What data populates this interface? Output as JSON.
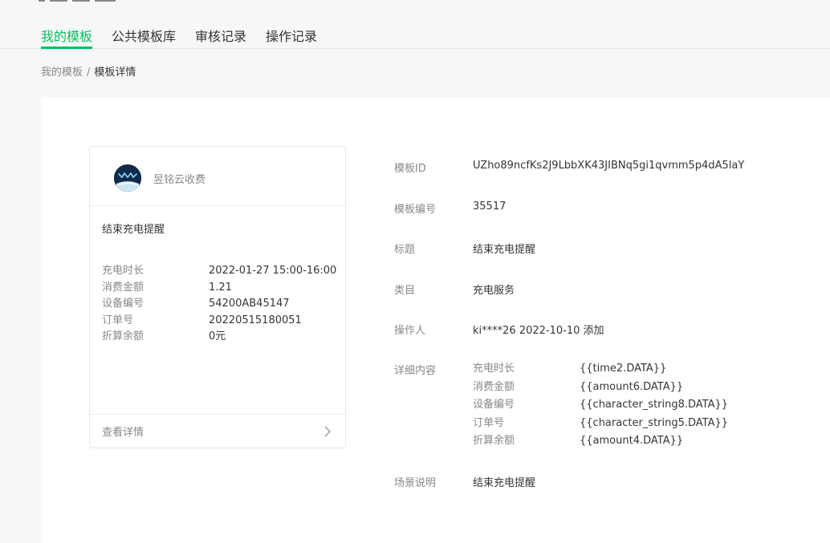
{
  "tabs": [
    {
      "label": "我的模板",
      "active": true
    },
    {
      "label": "公共模板库",
      "active": false
    },
    {
      "label": "审核记录",
      "active": false
    },
    {
      "label": "操作记录",
      "active": false
    }
  ],
  "breadcrumb": {
    "parent": "我的模板",
    "separator": "/",
    "current": "模板详情"
  },
  "card": {
    "brand_name": "昱铭云收费",
    "title": "结束充电提醒",
    "fields": [
      {
        "key": "充电时长",
        "value": "2022-01-27 15:00-16:00"
      },
      {
        "key": "消费金额",
        "value": "1.21"
      },
      {
        "key": "设备编号",
        "value": "54200AB45147"
      },
      {
        "key": "订单号",
        "value": "20220515180051"
      },
      {
        "key": "折算余额",
        "value": "0元"
      }
    ],
    "footer_label": "查看详情"
  },
  "detail": {
    "template_id": {
      "label": "模板ID",
      "value": "UZho89ncfKs2J9LbbXK43JIBNq5gi1qvmm5p4dA5laY"
    },
    "template_no": {
      "label": "模板编号",
      "value": "35517"
    },
    "title": {
      "label": "标题",
      "value": "结束充电提醒"
    },
    "category": {
      "label": "类目",
      "value": "充电服务"
    },
    "operator": {
      "label": "操作人",
      "value": "ki****26 2022-10-10 添加"
    },
    "content": {
      "label": "详细内容",
      "rows": [
        {
          "key": "充电时长",
          "value": "{{time2.DATA}}"
        },
        {
          "key": "消费金额",
          "value": "{{amount6.DATA}}"
        },
        {
          "key": "设备编号",
          "value": "{{character_string8.DATA}}"
        },
        {
          "key": "订单号",
          "value": "{{character_string5.DATA}}"
        },
        {
          "key": "折算余额",
          "value": "{{amount4.DATA}}"
        }
      ]
    },
    "scene": {
      "label": "场景说明",
      "value": "结束充电提醒"
    }
  },
  "colors": {
    "accent": "#07c160",
    "muted": "#888888",
    "text": "#353535"
  }
}
